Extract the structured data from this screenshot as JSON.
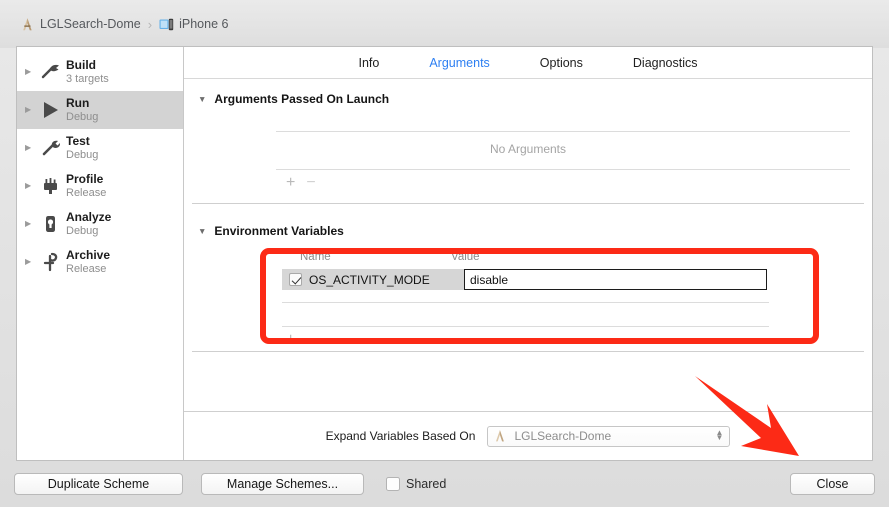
{
  "window": {
    "breadcrumb": {
      "project": "LGLSearch-Dome",
      "separator": "›",
      "device": "iPhone 6",
      "project_icon": "xcode-app-icon",
      "device_icon": "iphone-device-icon"
    }
  },
  "sidebar": {
    "items": [
      {
        "title": "Build",
        "subtitle": "3 targets",
        "icon": "hammer-icon",
        "selected": false
      },
      {
        "title": "Run",
        "subtitle": "Debug",
        "icon": "play-icon",
        "selected": true
      },
      {
        "title": "Test",
        "subtitle": "Debug",
        "icon": "wrench-icon",
        "selected": false
      },
      {
        "title": "Profile",
        "subtitle": "Release",
        "icon": "gauge-icon",
        "selected": false
      },
      {
        "title": "Analyze",
        "subtitle": "Debug",
        "icon": "stethoscope-icon",
        "selected": false
      },
      {
        "title": "Archive",
        "subtitle": "Release",
        "icon": "archive-icon",
        "selected": false
      }
    ]
  },
  "tabs": [
    {
      "label": "Info",
      "active": false
    },
    {
      "label": "Arguments",
      "active": true
    },
    {
      "label": "Options",
      "active": false
    },
    {
      "label": "Diagnostics",
      "active": false
    }
  ],
  "arguments_section": {
    "title": "Arguments Passed On Launch",
    "disclosure": "▼",
    "empty_text": "No Arguments",
    "add_label": "+",
    "remove_label": "−"
  },
  "environment_section": {
    "title": "Environment Variables",
    "disclosure": "▼",
    "columns": [
      "Name",
      "Value"
    ],
    "rows": [
      {
        "checked": true,
        "name": "OS_ACTIVITY_MODE",
        "value": "disable"
      }
    ],
    "add_label": "+",
    "remove_label": "−"
  },
  "expand_row": {
    "label": "Expand Variables Based On",
    "selected": "LGLSearch-Dome",
    "icon": "xcode-app-icon",
    "chevron_up": "▲",
    "chevron_down": "▼"
  },
  "bottom_bar": {
    "duplicate_label": "Duplicate Scheme",
    "manage_label": "Manage Schemes...",
    "shared_label": "Shared",
    "shared_checked": false,
    "close_label": "Close"
  },
  "annotations": {
    "highlight_color": "#fc2a16",
    "rectangle_target": "environment-variables-table",
    "arrow_target": "close-button"
  }
}
